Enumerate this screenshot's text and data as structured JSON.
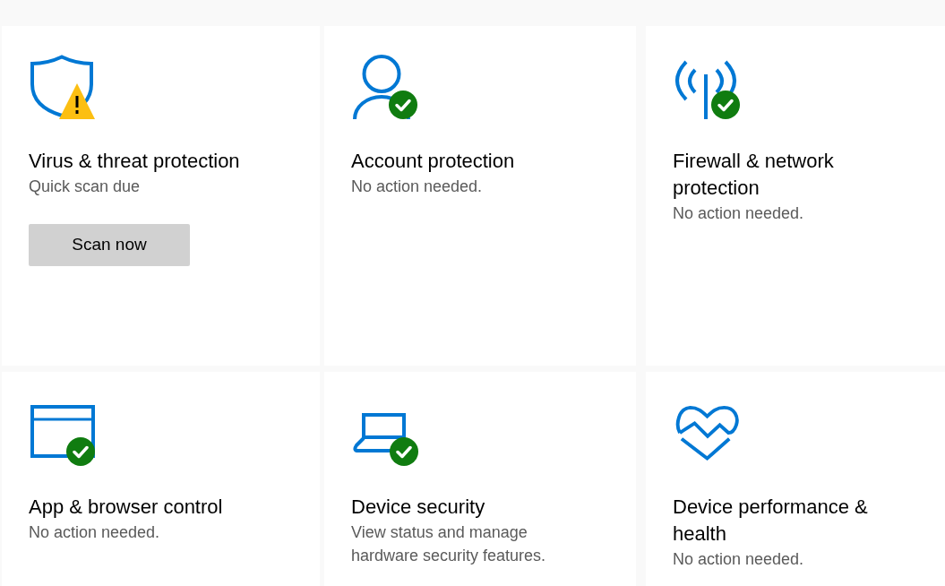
{
  "cards": [
    {
      "warning": true,
      "ok": false,
      "title": "Virus & threat protection",
      "subtitle": "Quick scan due",
      "button": "Scan now"
    },
    {
      "warning": false,
      "ok": true,
      "title": "Account protection",
      "subtitle": "No action needed."
    },
    {
      "warning": false,
      "ok": true,
      "title": "Firewall & network protection",
      "subtitle": "No action needed."
    },
    {
      "warning": false,
      "ok": true,
      "title": "App & browser control",
      "subtitle": "No action needed."
    },
    {
      "warning": false,
      "ok": true,
      "title": "Device security",
      "subtitle": "View status and manage hardware security features."
    },
    {
      "warning": false,
      "ok": false,
      "title": "Device performance & health",
      "subtitle": "No action needed."
    }
  ]
}
